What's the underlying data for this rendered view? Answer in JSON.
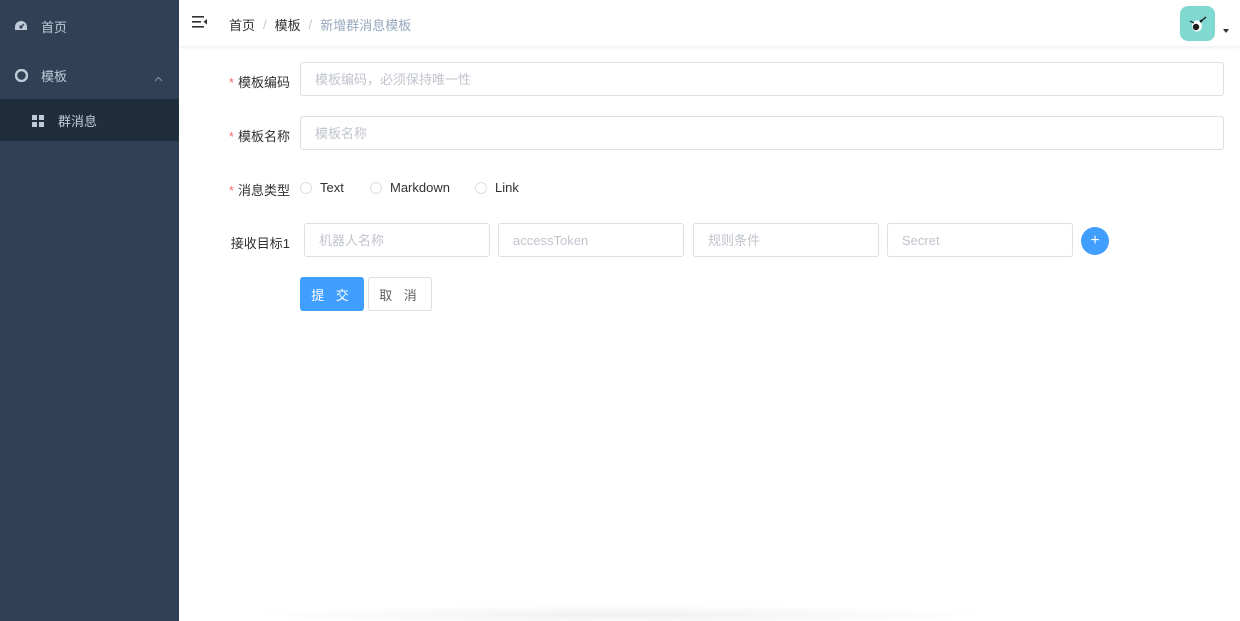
{
  "sidebar": {
    "home_label": "首页",
    "template_label": "模板",
    "group_message_label": "群消息"
  },
  "header": {
    "breadcrumb": [
      "首页",
      "模板",
      "新增群消息模板"
    ]
  },
  "form": {
    "code": {
      "label": "模板编码",
      "value": "",
      "placeholder": "模板编码，必须保持唯一性"
    },
    "name": {
      "label": "模板名称",
      "value": "",
      "placeholder": "模板名称"
    },
    "type": {
      "label": "消息类型",
      "options": [
        "Text",
        "Markdown",
        "Link"
      ],
      "selected": ""
    },
    "target": {
      "label": "接收目标1",
      "fields": [
        {
          "value": "",
          "placeholder": "机器人名称"
        },
        {
          "value": "",
          "placeholder": "accessToken"
        },
        {
          "value": "",
          "placeholder": "规则条件"
        },
        {
          "value": "",
          "placeholder": "Secret"
        }
      ],
      "add_label": "+"
    },
    "submit_label": "提 交",
    "cancel_label": "取 消"
  },
  "colors": {
    "sidebar_bg": "#304156",
    "submenu_bg": "#1f2d3d",
    "primary": "#409eff",
    "required": "#f56c6c"
  }
}
